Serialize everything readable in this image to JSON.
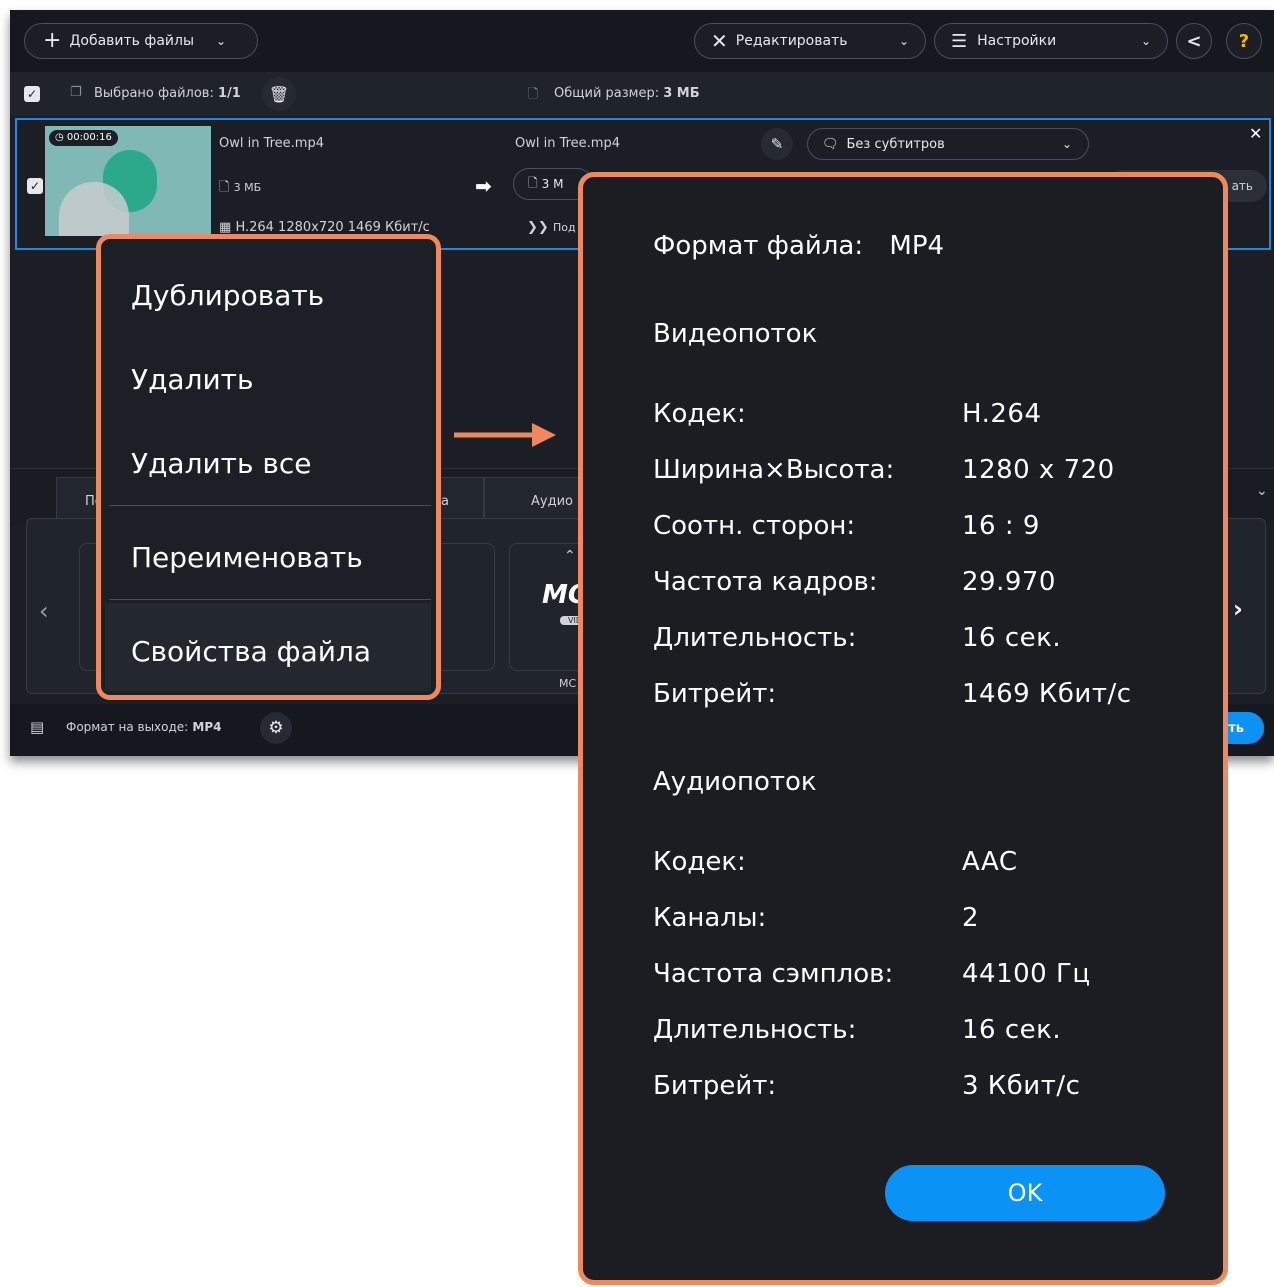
{
  "toolbar": {
    "add_files_label": "Добавить файлы",
    "edit_label": "Редактировать",
    "settings_label": "Настройки"
  },
  "selection_bar": {
    "selected_label": "Выбрано файлов:",
    "selected_value": "1/1",
    "total_size_label": "Общий размер:",
    "total_size_value": "3 МБ"
  },
  "file_row": {
    "duration": "00:00:16",
    "source_name": "Owl in Tree.mp4",
    "source_size": "3 МБ",
    "source_info": "H.264 1280x720 1469 Кбит/с",
    "output_name": "Owl in Tree.mp4",
    "output_size": "3 М",
    "output_extra": "Под",
    "subtitles": "Без субтитров",
    "partial_button": "ать"
  },
  "tabs": [
    "По",
    "а",
    "Аудио"
  ],
  "preset": {
    "logo_text": "MO",
    "logo_sub": "VID",
    "caption": "МС"
  },
  "bottom_bar": {
    "format_label": "Формат на выходе:",
    "format_value": "MP4",
    "partial_button": "ть"
  },
  "context_menu": {
    "items": [
      "Дублировать",
      "Удалить",
      "Удалить все",
      "Переименовать",
      "Свойства файла"
    ]
  },
  "properties_dialog": {
    "format_label": "Формат файла:",
    "format_value": "MP4",
    "video_heading": "Видеопоток",
    "video": [
      {
        "label": "Кодек:",
        "value": "H.264"
      },
      {
        "label": "Ширина×Высота:",
        "value": "1280 x 720"
      },
      {
        "label": "Соотн. сторон:",
        "value": "16 : 9"
      },
      {
        "label": "Частота кадров:",
        "value": "29.970"
      },
      {
        "label": "Длительность:",
        "value": "16 сек."
      },
      {
        "label": "Битрейт:",
        "value": "1469 Кбит/с"
      }
    ],
    "audio_heading": "Аудиопоток",
    "audio": [
      {
        "label": "Кодек:",
        "value": "AAC"
      },
      {
        "label": "Каналы:",
        "value": "2"
      },
      {
        "label": "Частота сэмплов:",
        "value": "44100 Гц"
      },
      {
        "label": "Длительность:",
        "value": "16 сек."
      },
      {
        "label": "Битрейт:",
        "value": "3 Кбит/с"
      }
    ],
    "ok_label": "OK"
  },
  "colors": {
    "highlight_border": "#f0885e",
    "accent_blue": "#0a93f5",
    "selection_border": "#1e88e5",
    "help_icon": "#f5b800"
  }
}
